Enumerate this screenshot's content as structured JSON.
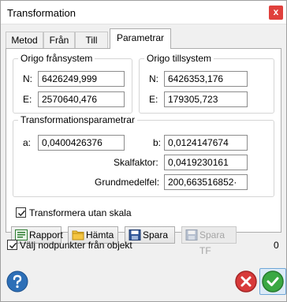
{
  "window": {
    "title": "Transformation",
    "close_glyph": "x"
  },
  "tabs": [
    {
      "label": "Metod"
    },
    {
      "label": "Från"
    },
    {
      "label": "Till"
    },
    {
      "label": "Parametrar",
      "active": true
    }
  ],
  "source_origin": {
    "title": "Origo frånsystem",
    "n_label": "N:",
    "n_value": "6426249,999",
    "e_label": "E:",
    "e_value": "2570640,476"
  },
  "target_origin": {
    "title": "Origo tillsystem",
    "n_label": "N:",
    "n_value": "6426353,176",
    "e_label": "E:",
    "e_value": "179305,723"
  },
  "params": {
    "title": "Transformationsparametrar",
    "a_label": "a:",
    "a_value": "0,0400426376",
    "b_label": "b:",
    "b_value": "0,0124147674",
    "scale_label": "Skalfaktor:",
    "scale_value": "0,0419230161",
    "error_label": "Grundmedelfel:",
    "error_value": "200,663516852·"
  },
  "transform_without_scale": {
    "label": "Transformera utan skala",
    "checked": true
  },
  "buttons": {
    "report": "Rapport",
    "fetch": "Hämta",
    "save": "Spara",
    "save_tf": "Spara TF"
  },
  "select_nodepoints": {
    "label": "Välj nodpunkter från objekt",
    "checked": true
  },
  "count": "0",
  "icons": {
    "help": "help-icon",
    "cancel": "cancel-icon",
    "ok": "ok-icon"
  },
  "colors": {
    "close": "#e0403c",
    "help": "#2d6fb7",
    "cancel": "#d83a3a",
    "ok": "#3aa843"
  }
}
